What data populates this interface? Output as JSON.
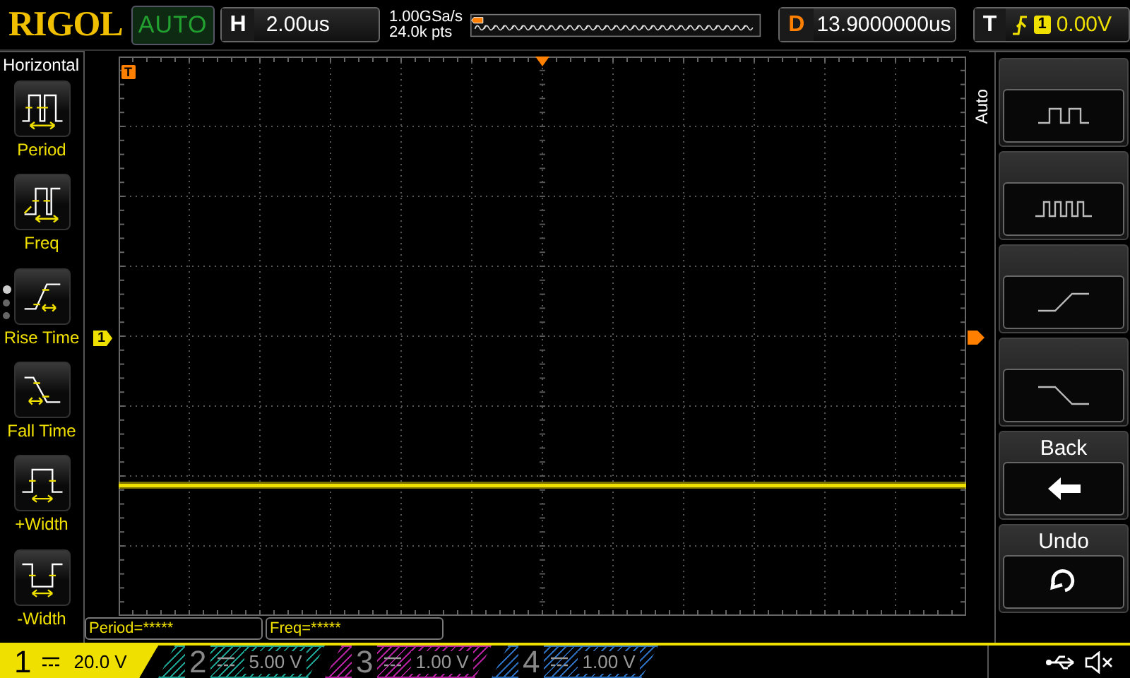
{
  "header": {
    "logo": "RIGOL",
    "run_status": "AUTO",
    "timebase": {
      "label": "H",
      "value": "2.00us"
    },
    "sample_rate": "1.00GSa/s",
    "memory_depth": "24.0k pts",
    "delay": {
      "label": "D",
      "value": "13.9000000us"
    },
    "trigger": {
      "label": "T",
      "source": "1",
      "level": "0.00V"
    }
  },
  "menu": {
    "title": "Horizontal",
    "pages": [
      {
        "selected": true
      },
      {
        "selected": false
      },
      {
        "selected": false
      }
    ],
    "items": [
      {
        "label": "Period",
        "kind": "period"
      },
      {
        "label": "Freq",
        "kind": "freq"
      },
      {
        "label": "Rise Time",
        "kind": "rise"
      },
      {
        "label": "Fall Time",
        "kind": "fall"
      },
      {
        "label": "+Width",
        "kind": "pwidth"
      },
      {
        "label": "-Width",
        "kind": "nwidth"
      }
    ]
  },
  "screen": {
    "channel_marker": "1",
    "trigger_marker": "T"
  },
  "softkeys": {
    "title": "Auto",
    "keys": [
      {
        "kind": "square"
      },
      {
        "kind": "burst"
      },
      {
        "kind": "rise"
      },
      {
        "kind": "fall"
      },
      {
        "kind": "back",
        "label": "Back"
      },
      {
        "kind": "undo",
        "label": "Undo"
      }
    ]
  },
  "measurements": [
    "Period=*****",
    "Freq=*****"
  ],
  "channels": [
    {
      "number": "1",
      "scale": "20.0 V",
      "color": "#f0e000",
      "selected": true
    },
    {
      "number": "2",
      "scale": "5.00 V",
      "color": "#1c9c8c",
      "selected": false
    },
    {
      "number": "3",
      "scale": "1.00 V",
      "color": "#b0209c",
      "selected": false
    },
    {
      "number": "4",
      "scale": "1.00 V",
      "color": "#2a6cb8",
      "selected": false
    }
  ]
}
